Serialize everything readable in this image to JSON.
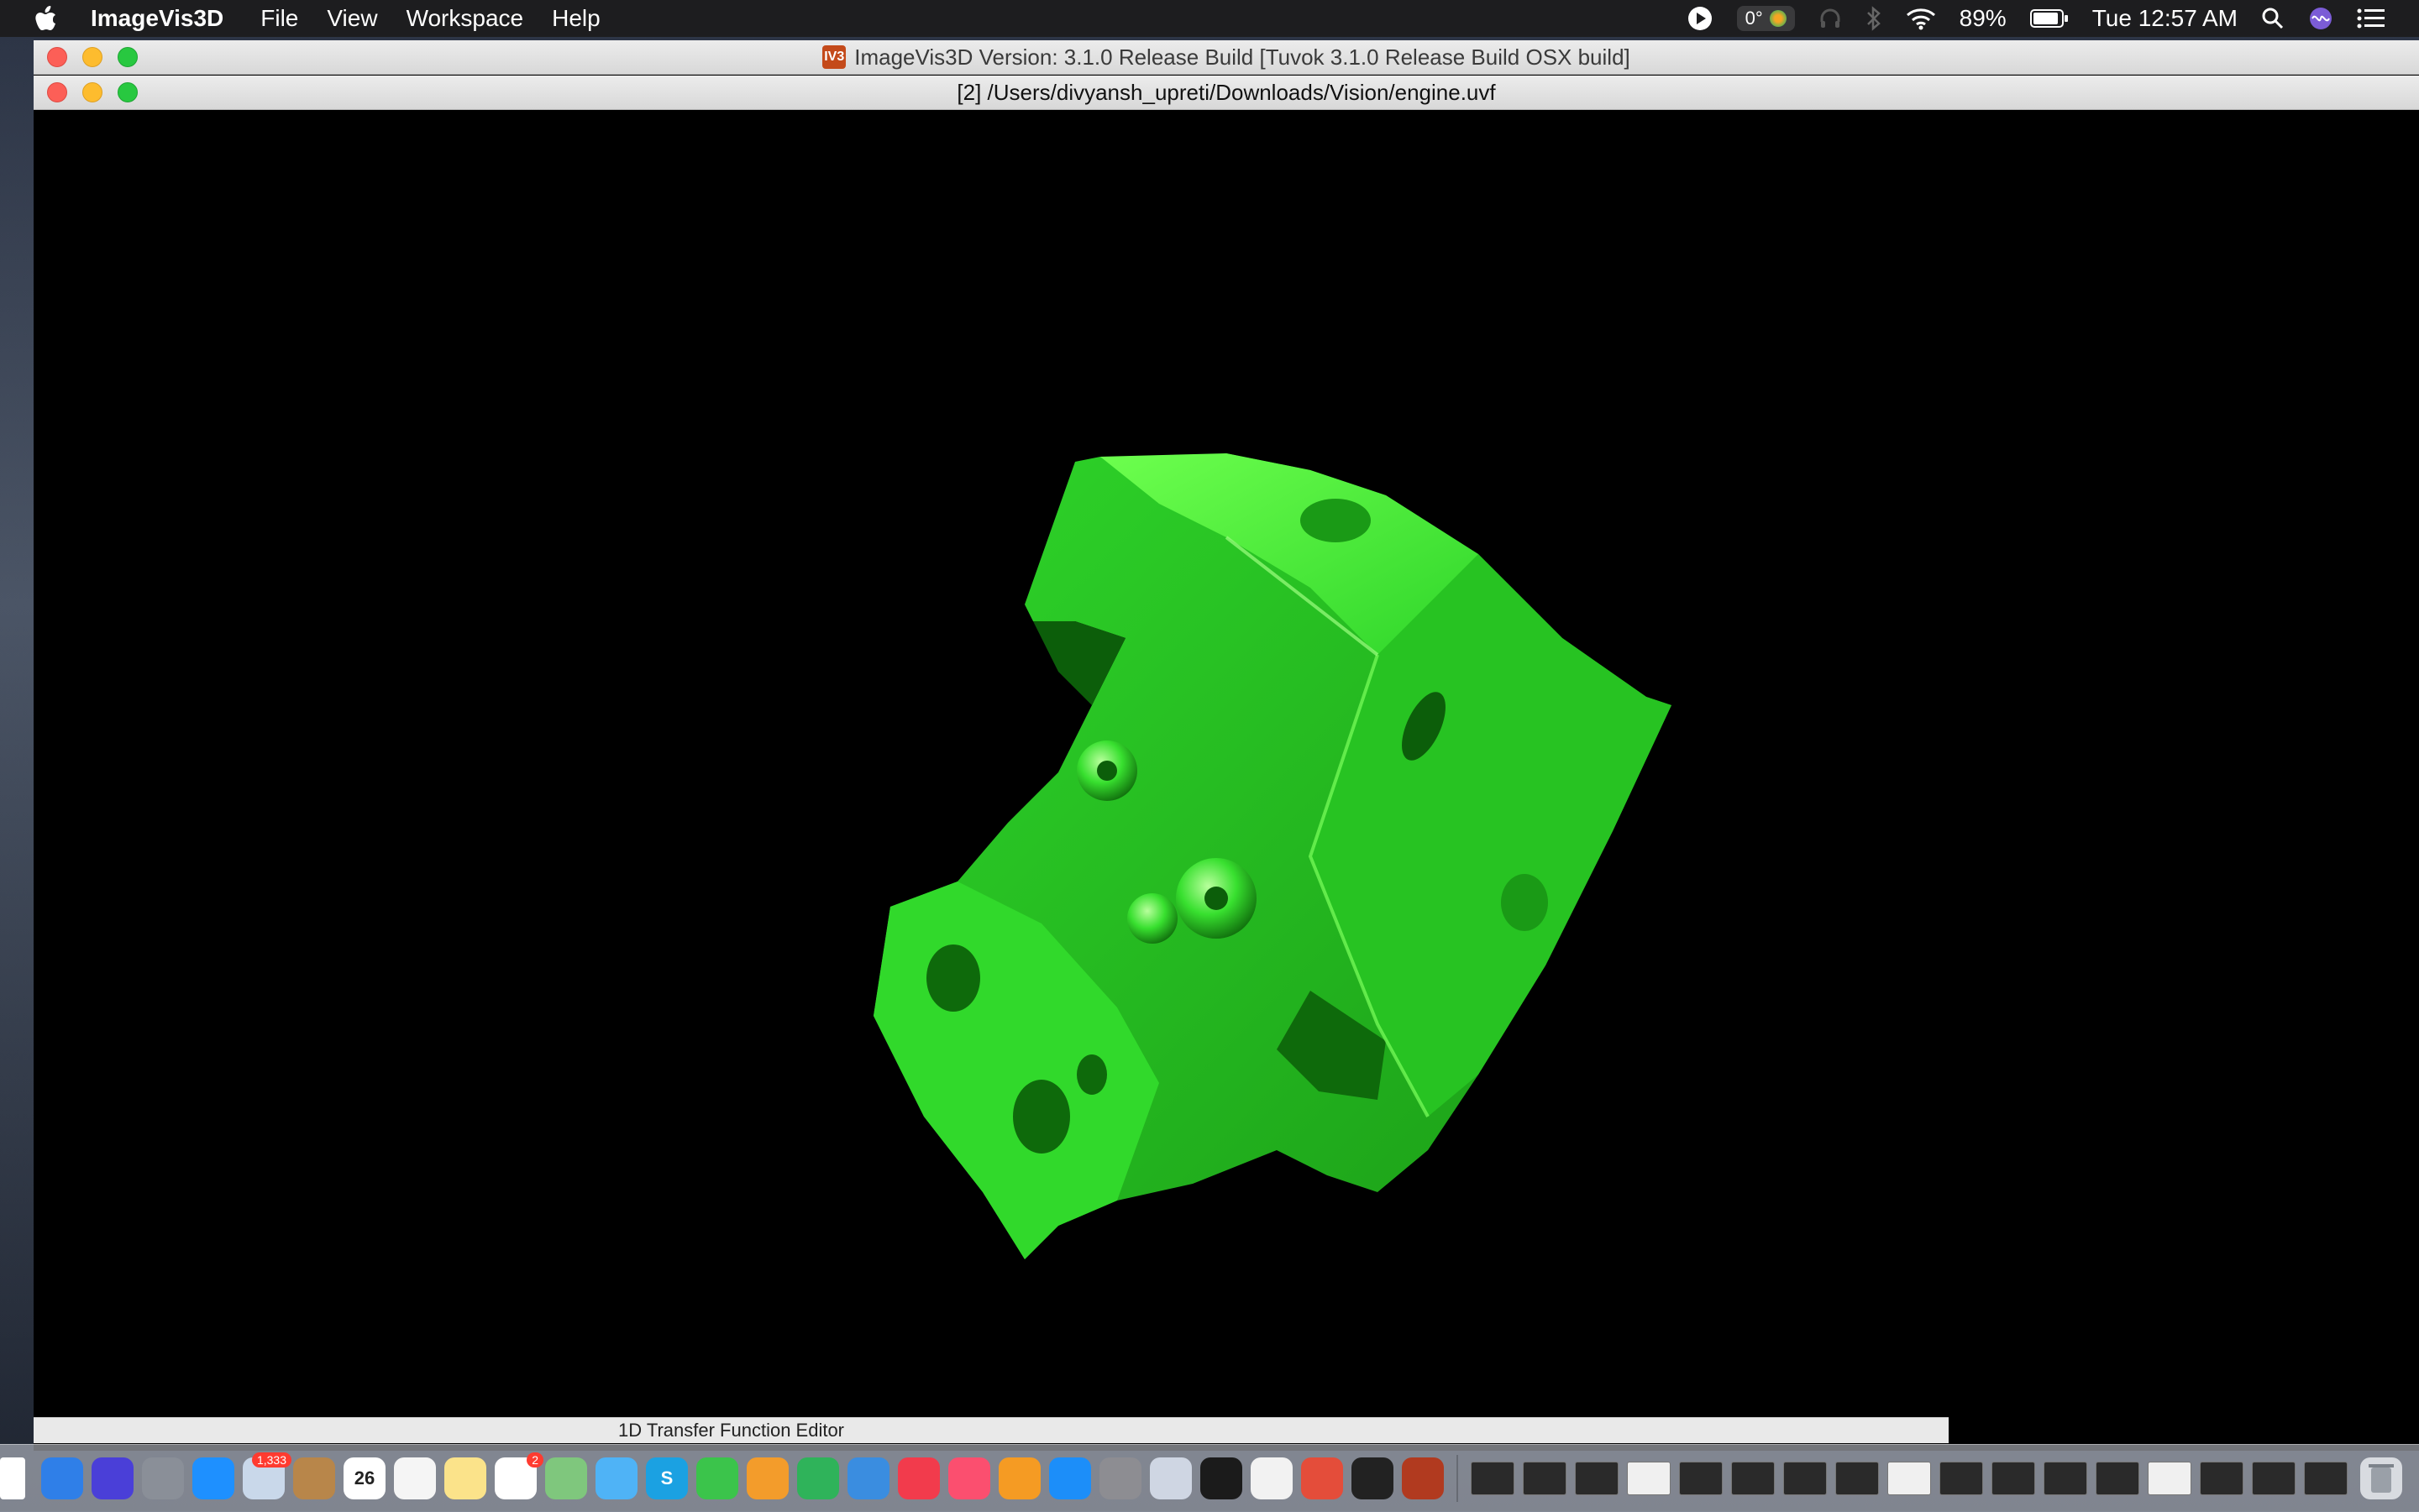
{
  "menubar": {
    "app_name": "ImageVis3D",
    "items": [
      "File",
      "View",
      "Workspace",
      "Help"
    ],
    "status": {
      "temperature": "0°",
      "battery": "89%",
      "clock": "Tue 12:57 AM"
    }
  },
  "windows": {
    "main_title": "ImageVis3D Version: 3.1.0 Release Build [Tuvok 3.1.0 Release Build OSX build]",
    "logo_text": "IV3",
    "render_title": "[2] /Users/divyansh_upreti/Downloads/Vision/engine.uvf"
  },
  "render": {
    "background_color": "#000000",
    "model_color": "#2fd62a",
    "model_highlight": "#7cff5c",
    "model_shadow": "#0c5e0a"
  },
  "transfer_function": {
    "label": "1D Transfer Function Editor"
  },
  "dock": {
    "apps": [
      {
        "name": "finder",
        "color": "#2f7fe8"
      },
      {
        "name": "siri",
        "color": "#4a3fd8"
      },
      {
        "name": "launchpad",
        "color": "#8a8f98"
      },
      {
        "name": "safari",
        "color": "#1e90ff"
      },
      {
        "name": "mail",
        "color": "#c9d8ea",
        "badge": "1,333"
      },
      {
        "name": "contacts",
        "color": "#b8864a"
      },
      {
        "name": "calendar",
        "color": "#ffffff",
        "text": "26"
      },
      {
        "name": "photos",
        "color": "#f5f5f5"
      },
      {
        "name": "notes",
        "color": "#fbe38a"
      },
      {
        "name": "reminders",
        "color": "#ffffff",
        "badge": "2"
      },
      {
        "name": "maps",
        "color": "#7fc77d"
      },
      {
        "name": "messages",
        "color": "#4fb3f6"
      },
      {
        "name": "skype",
        "color": "#1ba1e2",
        "text": "S"
      },
      {
        "name": "facetime",
        "color": "#3bc44b"
      },
      {
        "name": "pages",
        "color": "#f39c2b"
      },
      {
        "name": "numbers",
        "color": "#2fb35a"
      },
      {
        "name": "keynote",
        "color": "#3a8de0"
      },
      {
        "name": "news",
        "color": "#f23b4c"
      },
      {
        "name": "music",
        "color": "#fb4f6f"
      },
      {
        "name": "books",
        "color": "#f59b23"
      },
      {
        "name": "app-store",
        "color": "#1c8ef9"
      },
      {
        "name": "system-preferences",
        "color": "#8d8d92"
      },
      {
        "name": "imagevis3d",
        "color": "#cfd6e3"
      },
      {
        "name": "terminal",
        "color": "#1b1b1b"
      },
      {
        "name": "textedit",
        "color": "#f2f2f2"
      },
      {
        "name": "chrome",
        "color": "#e44d3a"
      },
      {
        "name": "unity",
        "color": "#222222"
      },
      {
        "name": "instruments",
        "color": "#b13a1f"
      }
    ],
    "minimized_count": 17
  }
}
